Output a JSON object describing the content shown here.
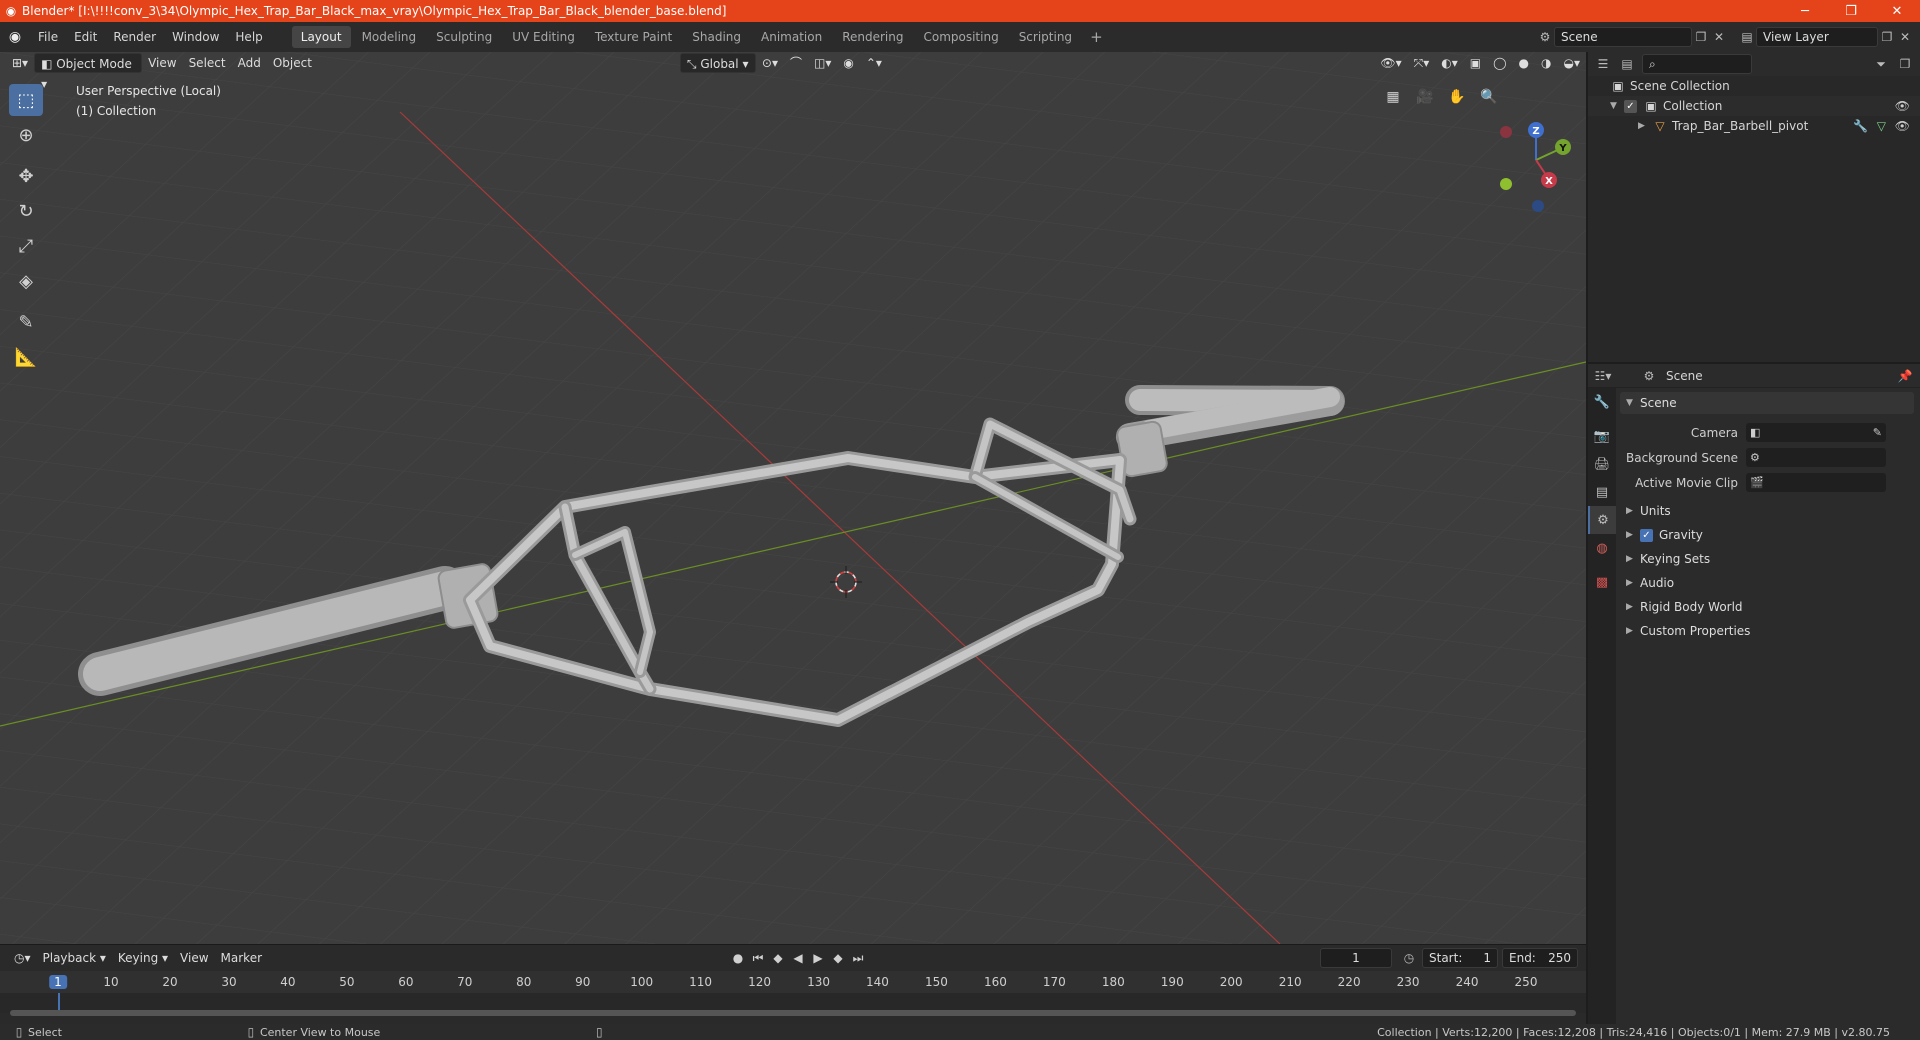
{
  "window": {
    "title": "Blender* [I:\\!!!!conv_3\\34\\Olympic_Hex_Trap_Bar_Black_max_vray\\Olympic_Hex_Trap_Bar_Black_blender_base.blend]",
    "minimize": "─",
    "maximize": "❐",
    "close": "✕"
  },
  "menu": [
    "File",
    "Edit",
    "Render",
    "Window",
    "Help"
  ],
  "workspaces": [
    {
      "label": "Layout",
      "active": true
    },
    {
      "label": "Modeling"
    },
    {
      "label": "Sculpting"
    },
    {
      "label": "UV Editing"
    },
    {
      "label": "Texture Paint"
    },
    {
      "label": "Shading"
    },
    {
      "label": "Animation"
    },
    {
      "label": "Rendering"
    },
    {
      "label": "Compositing"
    },
    {
      "label": "Scripting"
    }
  ],
  "scene_field": "Scene",
  "view_layer_field": "View Layer",
  "viewport": {
    "mode": "Object Mode",
    "menus": [
      "View",
      "Select",
      "Add",
      "Object"
    ],
    "transform_orientation": "Global",
    "perspective_label": "User Perspective (Local)",
    "collection_label": "(1) Collection",
    "gizmo_axes": {
      "z": "Z",
      "y": "Y",
      "x": "X"
    }
  },
  "outliner": {
    "scene_collection": "Scene Collection",
    "collection": "Collection",
    "object": "Trap_Bar_Barbell_pivot"
  },
  "properties": {
    "header_title": "Scene",
    "panel_title": "Scene",
    "camera_label": "Camera",
    "background_scene_label": "Background Scene",
    "active_movie_clip_label": "Active Movie Clip",
    "subpanels": [
      "Units",
      "Gravity",
      "Keying Sets",
      "Audio",
      "Rigid Body World",
      "Custom Properties"
    ]
  },
  "timeline": {
    "menus": [
      "Playback",
      "Keying",
      "View",
      "Marker"
    ],
    "current_frame": "1",
    "start_label": "Start:",
    "start_value": "1",
    "end_label": "End:",
    "end_value": "250",
    "ruler": [
      "1",
      "10",
      "20",
      "30",
      "40",
      "50",
      "60",
      "70",
      "80",
      "90",
      "100",
      "110",
      "120",
      "130",
      "140",
      "150",
      "160",
      "170",
      "180",
      "190",
      "200",
      "210",
      "220",
      "230",
      "240",
      "250"
    ]
  },
  "statusbar": {
    "select": "Select",
    "center_view": "Center View to Mouse",
    "stats": "Collection | Verts:12,200 | Faces:12,208 | Tris:24,416 | Objects:0/1 | Mem: 27.9 MB | v2.80.75"
  },
  "colors": {
    "title_bar": "#e5431a",
    "viewport_bg": "#3d3d3d",
    "axis_x": "#a83a3a",
    "axis_y": "#6b8e23",
    "active_blue": "#4772b3"
  }
}
